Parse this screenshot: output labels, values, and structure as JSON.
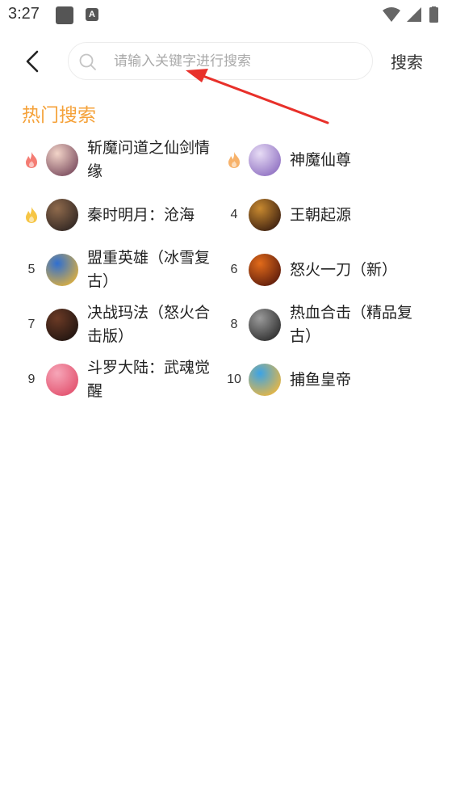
{
  "status_bar": {
    "time": "3:27",
    "app_badge": "A",
    "icons": [
      "notification-square-icon",
      "app-a-icon",
      "wifi-icon",
      "signal-icon",
      "battery-icon"
    ]
  },
  "search": {
    "placeholder": "请输入关键字进行搜索",
    "value": "",
    "button_label": "搜索"
  },
  "hot": {
    "title": "热门搜索",
    "accent_color": "#f5a23a",
    "items": [
      {
        "rank": "",
        "rank_icon": "flame-icon",
        "rank_color": "#f47c73",
        "name": "斩魔问道之仙剑情缘",
        "icon_colors": [
          "#f2d4c8",
          "#7a4b5e"
        ]
      },
      {
        "rank": "",
        "rank_icon": "flame-icon",
        "rank_color": "#f7b26a",
        "name": "神魔仙尊",
        "icon_colors": [
          "#e7dcf5",
          "#8e6fc1"
        ]
      },
      {
        "rank": "",
        "rank_icon": "flame-icon",
        "rank_color": "#f6c544",
        "name": "秦时明月：沧海",
        "icon_colors": [
          "#8f6a4c",
          "#2f2522"
        ]
      },
      {
        "rank": "4",
        "rank_icon": "",
        "rank_color": "#333333",
        "name": "王朝起源",
        "icon_colors": [
          "#c8892f",
          "#3a1e10"
        ]
      },
      {
        "rank": "5",
        "rank_icon": "",
        "rank_color": "#333333",
        "name": "盟重英雄（冰雪复古）",
        "icon_colors": [
          "#2f6fd1",
          "#e2b13a"
        ]
      },
      {
        "rank": "6",
        "rank_icon": "",
        "rank_color": "#333333",
        "name": "怒火一刀（新）",
        "icon_colors": [
          "#e26b1a",
          "#5a1a0c"
        ]
      },
      {
        "rank": "7",
        "rank_icon": "",
        "rank_color": "#333333",
        "name": "决战玛法（怒火合击版）",
        "icon_colors": [
          "#6b3a25",
          "#1f1410"
        ]
      },
      {
        "rank": "8",
        "rank_icon": "",
        "rank_color": "#333333",
        "name": "热血合击（精品复古）",
        "icon_colors": [
          "#9a9a9a",
          "#2c2c2c"
        ]
      },
      {
        "rank": "9",
        "rank_icon": "",
        "rank_color": "#333333",
        "name": "斗罗大陆：武魂觉醒",
        "icon_colors": [
          "#f6a6b8",
          "#e2506d"
        ]
      },
      {
        "rank": "10",
        "rank_icon": "",
        "rank_color": "#333333",
        "name": "捕鱼皇帝",
        "icon_colors": [
          "#3ba3e6",
          "#f0b73b"
        ]
      }
    ]
  }
}
